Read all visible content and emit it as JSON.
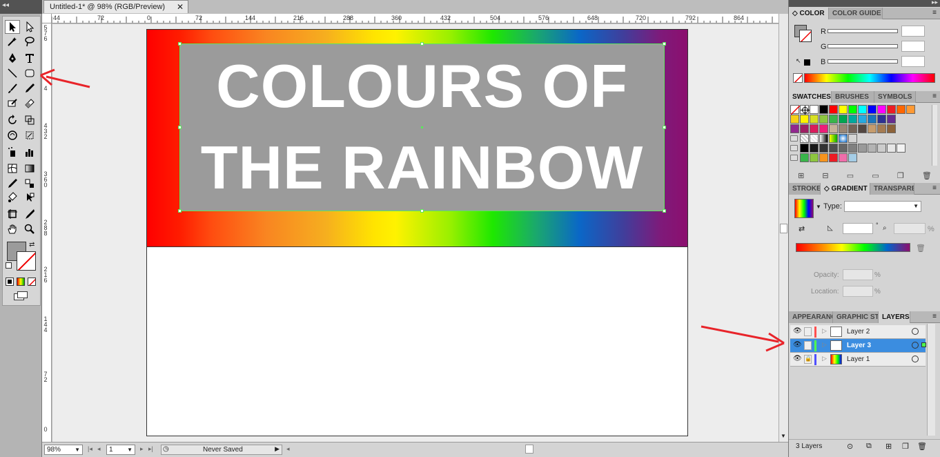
{
  "document": {
    "tab_title": "Untitled-1* @ 98% (RGB/Preview)",
    "close_glyph": "✕",
    "headline_line1": "COLOURS OF",
    "headline_line2": "THE RAINBOW",
    "ruler_h_labels": [
      "44",
      "72",
      "0",
      "72",
      "144",
      "216",
      "288",
      "360",
      "432",
      "504",
      "576",
      "648",
      "720",
      "792",
      "864"
    ],
    "ruler_v_labels": [
      "5\n7\n6",
      "4",
      "4\n3\n2",
      "3\n6\n0",
      "2\n8\n8",
      "2\n1\n6",
      "1\n4\n4",
      "7\n2",
      "0"
    ]
  },
  "statusbar": {
    "zoom": "98%",
    "artboard": "1",
    "save_status": "Never Saved"
  },
  "color_panel": {
    "tabs": [
      "COLOR",
      "COLOR GUIDE"
    ],
    "channels": [
      "R",
      "G",
      "B"
    ]
  },
  "swatches_panel": {
    "tabs": [
      "SWATCHES",
      "BRUSHES",
      "SYMBOLS"
    ],
    "row1": [
      "#ffffff",
      "#000000",
      "#ff0000",
      "#ffff00",
      "#00ff00",
      "#00ffff",
      "#0000ff",
      "#ff00ff",
      "#ed1c24",
      "#ff6600",
      "#ff9933"
    ],
    "row2": [
      "#f7d117",
      "#fff200",
      "#d7df23",
      "#8dc63f",
      "#39b54a",
      "#00a651",
      "#00a99d",
      "#27aae1",
      "#1c75bc",
      "#2e3192",
      "#662d91"
    ],
    "row3": [
      "#92278f",
      "#9e1f63",
      "#d91c5c",
      "#ed1e79",
      "#c7b299",
      "#998675",
      "#736357",
      "#534741",
      "#c69c6d",
      "#a67c52",
      "#8c6239"
    ],
    "row5": [
      "#000000",
      "#1a1a1a",
      "#333333",
      "#4d4d4d",
      "#666666",
      "#808080",
      "#999999",
      "#b3b3b3",
      "#cccccc",
      "#e6e6e6",
      "#f2f2f2"
    ],
    "row6": [
      "#39b54a",
      "#8dc63f",
      "#f7941d",
      "#ed1c24",
      "#f06eaa",
      "#a5cde6"
    ]
  },
  "gradient_panel": {
    "tabs": [
      "STROKE",
      "GRADIENT",
      "TRANSPARENCY"
    ],
    "type_label": "Type:",
    "opacity_label": "Opacity:",
    "location_label": "Location:",
    "percent": "%",
    "degree": "°"
  },
  "layers_panel": {
    "tabs": [
      "APPEARANCE",
      "GRAPHIC STYLES",
      "LAYERS"
    ],
    "layers": [
      {
        "name": "Layer 2",
        "color": "#ff4f4f",
        "selected": false,
        "locked": false
      },
      {
        "name": "Layer 3",
        "color": "#4fff4f",
        "selected": true,
        "locked": false
      },
      {
        "name": "Layer 1",
        "color": "#4f4fff",
        "selected": false,
        "locked": true
      }
    ],
    "count": "3 Layers"
  },
  "colors": {
    "selection": "#5be65b",
    "arrow": "#e8242a",
    "layer_selected": "#3b8de0"
  }
}
